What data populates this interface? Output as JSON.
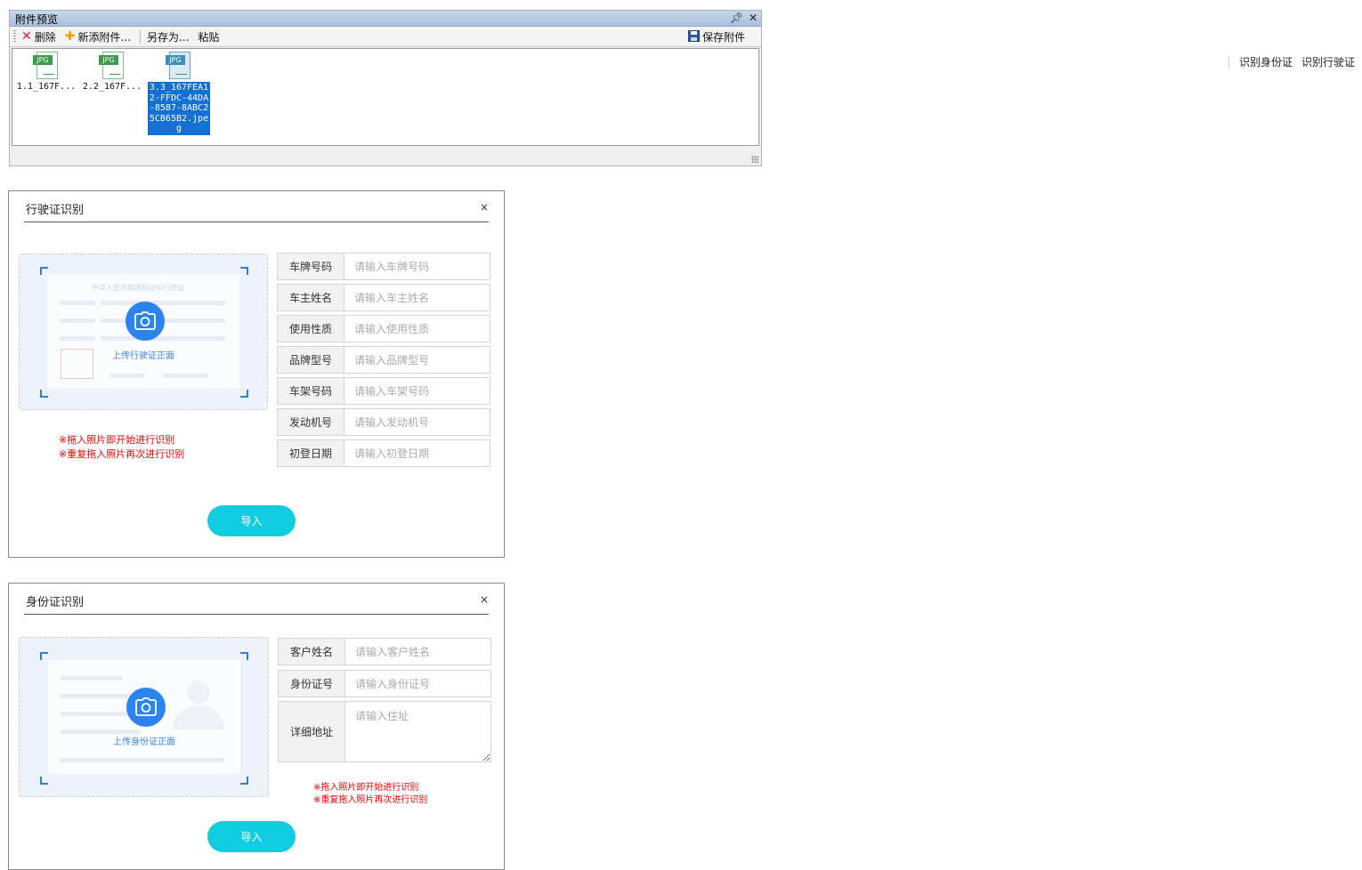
{
  "attach": {
    "title": "附件预览",
    "pin_icon": "pin-icon",
    "close_icon": "close-icon",
    "toolbar": {
      "delete": "删除",
      "add": "新添附件...",
      "save_as": "另存为...",
      "paste": "粘贴",
      "save_attach": "保存附件"
    },
    "files": [
      {
        "type": "JPG",
        "name": "1.1_167F..."
      },
      {
        "type": "JPG",
        "name": "2.2_167F..."
      },
      {
        "type": "JPG",
        "name": "3.3_167FEA12-FFDC-44DA-8587-8ABC25CB65B2.jpeg"
      }
    ]
  },
  "top_links": {
    "id_card": "识别身份证",
    "vehicle": "识别行驶证"
  },
  "vehicle_dialog": {
    "title": "行驶证识别",
    "close": "×",
    "card_title": "中华人民共和国机动车行驶证",
    "upload_label": "上传行驶证正面",
    "fields": [
      {
        "label": "车牌号码",
        "placeholder": "请输入车牌号码"
      },
      {
        "label": "车主姓名",
        "placeholder": "请输入车主姓名"
      },
      {
        "label": "使用性质",
        "placeholder": "请输入使用性质"
      },
      {
        "label": "品牌型号",
        "placeholder": "请输入品牌型号"
      },
      {
        "label": "车架号码",
        "placeholder": "请输入车架号码"
      },
      {
        "label": "发动机号",
        "placeholder": "请输入发动机号"
      },
      {
        "label": "初登日期",
        "placeholder": "请输入初登日期"
      }
    ],
    "hint1": "※拖入照片即开始进行识别",
    "hint2": "※重复拖入照片再次进行识别",
    "import_btn": "导入"
  },
  "id_dialog": {
    "title": "身份证识别",
    "close": "×",
    "upload_label": "上传身份证正面",
    "fields": [
      {
        "label": "客户姓名",
        "placeholder": "请输入客户姓名"
      },
      {
        "label": "身份证号",
        "placeholder": "请输入身份证号"
      },
      {
        "label": "详细地址",
        "placeholder": "请输入住址"
      }
    ],
    "hint1": "※拖入照片即开始进行识别",
    "hint2": "※重复拖入照片再次进行识别",
    "import_btn": "导入"
  },
  "colors": {
    "accent": "#12cde1",
    "camera": "#2a84f0",
    "hint": "#ee0000",
    "selection": "#1470d3"
  }
}
